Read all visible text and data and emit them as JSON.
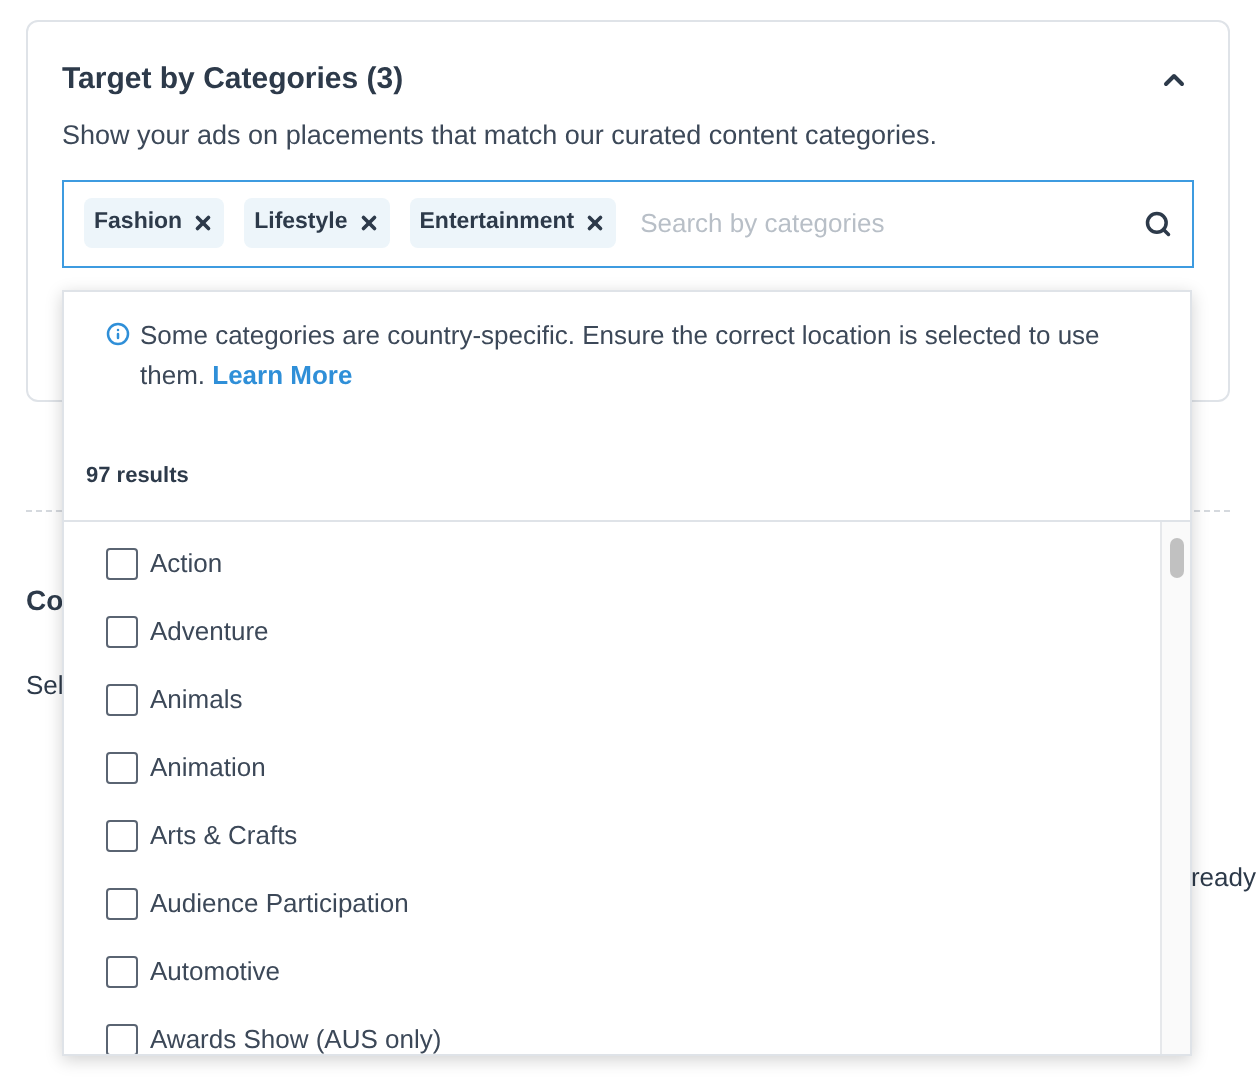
{
  "section": {
    "title": "Target by Categories (3)",
    "expanded": true,
    "description": "Show your ads on placements that match our curated content categories."
  },
  "search": {
    "chips": [
      "Fashion",
      "Lifestyle",
      "Entertainment"
    ],
    "placeholder": "Search by categories"
  },
  "dropdown": {
    "notice": "Some categories are country-specific. Ensure the correct location is selected to use them.",
    "link": "Learn More",
    "results": "97 results",
    "items": [
      {
        "label": "Action",
        "checked": false
      },
      {
        "label": "Adventure",
        "checked": false
      },
      {
        "label": "Animals",
        "checked": false
      },
      {
        "label": "Animation",
        "checked": false
      },
      {
        "label": "Arts & Crafts",
        "checked": false
      },
      {
        "label": "Audience Participation",
        "checked": false
      },
      {
        "label": "Automotive",
        "checked": false
      },
      {
        "label": "Awards Show (AUS only)",
        "checked": false
      }
    ]
  },
  "background": {
    "heading": "Co",
    "text": "Sel",
    "side_text": "ready"
  }
}
